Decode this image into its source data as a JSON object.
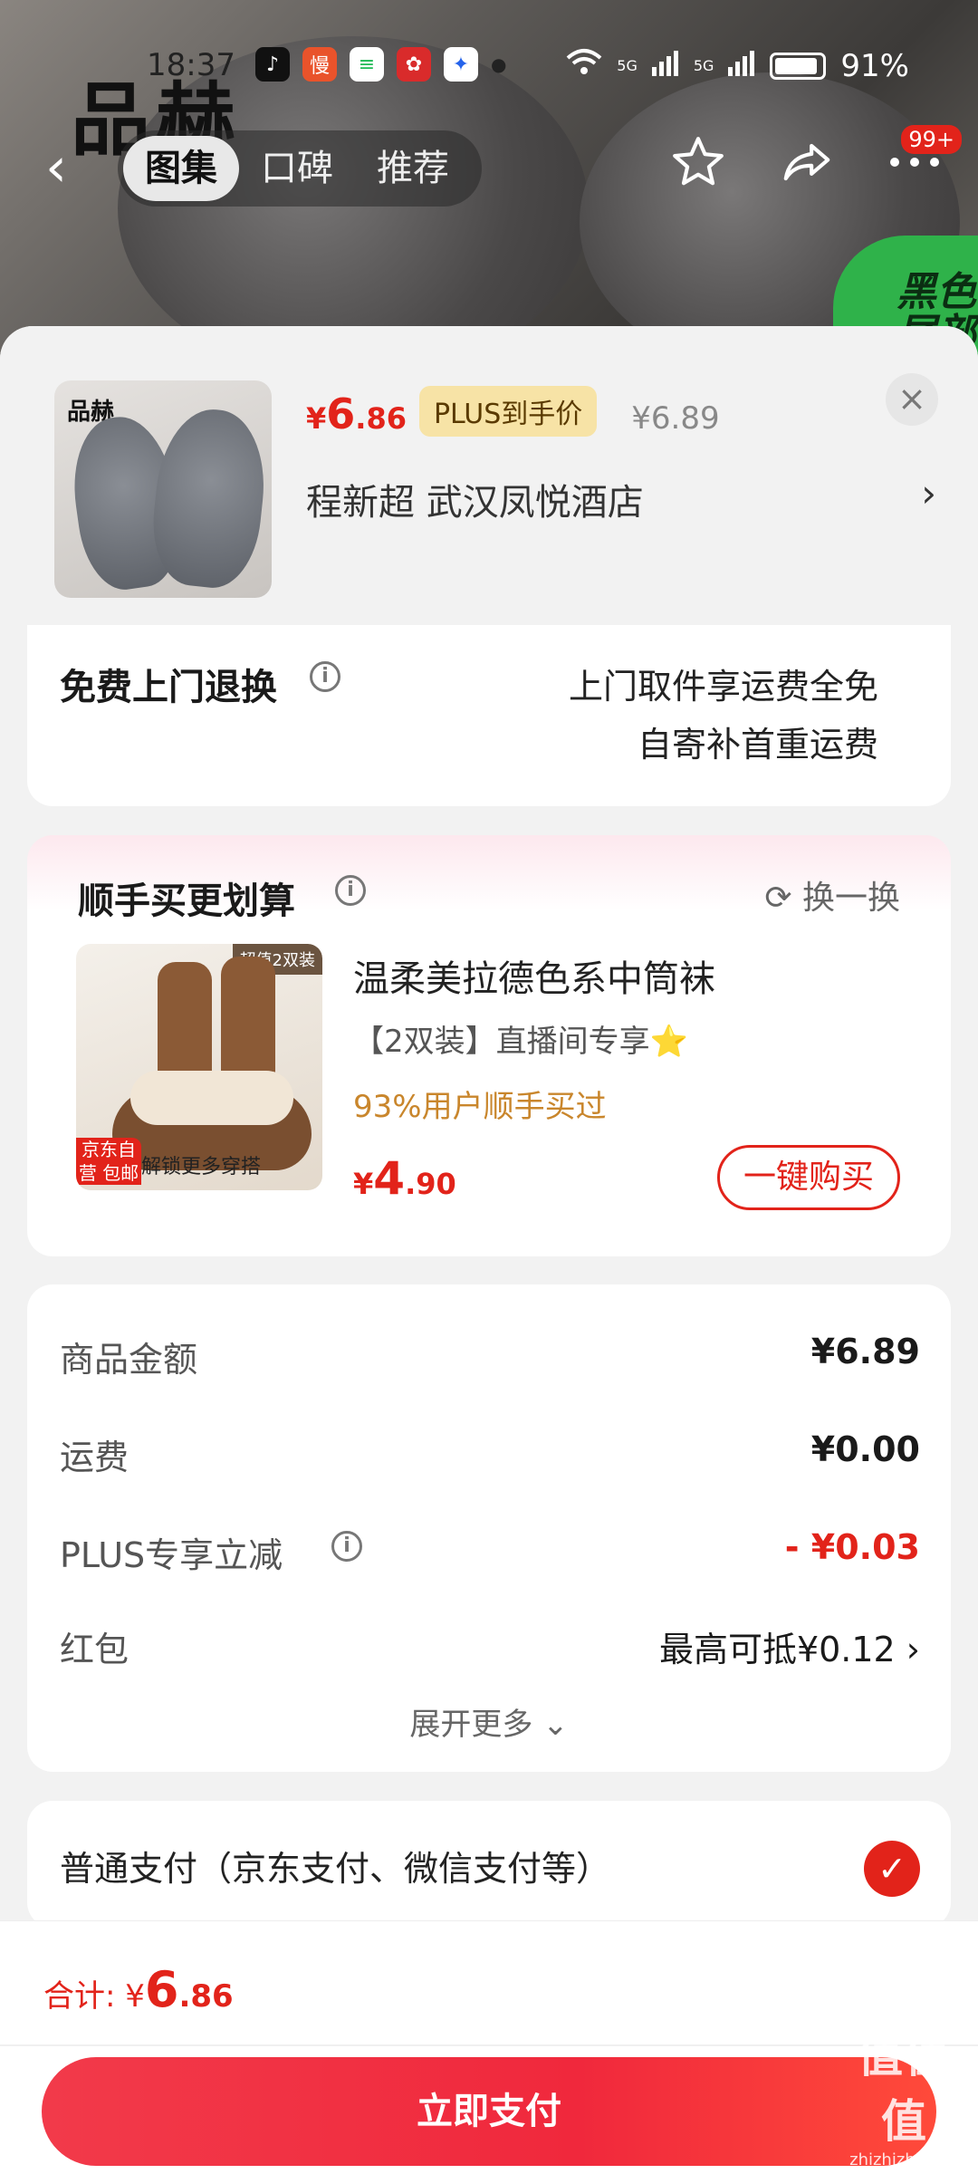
{
  "status_bar": {
    "time": "18:37",
    "signal_labels": [
      "5G",
      "5G"
    ],
    "battery": "91%"
  },
  "hero": {
    "brand_watermark": "品赫",
    "corner_promo": "黑色 尾部下"
  },
  "nav": {
    "tabs": [
      {
        "label": "图集",
        "active": true
      },
      {
        "label": "口碑",
        "active": false
      },
      {
        "label": "推荐",
        "active": false
      }
    ],
    "badge": "99+"
  },
  "product": {
    "thumb_brand": "品赫",
    "currency": "¥",
    "price_int": "6",
    "price_dec": ".86",
    "plus_tag": "PLUS到手价",
    "original_price": "¥6.89",
    "address": "程新超  武汉凤悦酒店"
  },
  "return_service": {
    "title": "免费上门退换",
    "line1": "上门取件享运费全免",
    "line2": "自寄补首重运费"
  },
  "combo": {
    "title": "顺手买更划算",
    "swap": "换一换",
    "image_tag": "超值2双装",
    "image_ship": "京东自营 包邮",
    "image_caption": "解锁更多穿搭",
    "name": "温柔美拉德色系中筒袜",
    "subtitle": "【2双装】直播间专享⭐",
    "percent": "93%用户顺手买过",
    "price_int": "4",
    "price_dec": ".90",
    "buy_label": "一键购买"
  },
  "amounts": {
    "rows": [
      {
        "label": "商品金额",
        "value": "¥6.89"
      },
      {
        "label": "运费",
        "value": "¥0.00"
      },
      {
        "label": "PLUS专享立减",
        "value": "- ¥0.03"
      },
      {
        "label": "红包",
        "value": "最高可抵¥0.12 ›"
      }
    ],
    "expand": "展开更多 ⌄"
  },
  "payment": {
    "label": "普通支付（京东支付、微信支付等）"
  },
  "footer": {
    "total_label": "合计: ",
    "currency": "¥",
    "total_int": "6",
    "total_dec": ".86",
    "pay_button": "立即支付",
    "watermark": "值值值",
    "watermark_url": "zhizhizhi.com"
  },
  "colors": {
    "accent": "#e2231a",
    "plus_tag_bg": "#f7e3a6",
    "percent_text": "#c9862c"
  }
}
